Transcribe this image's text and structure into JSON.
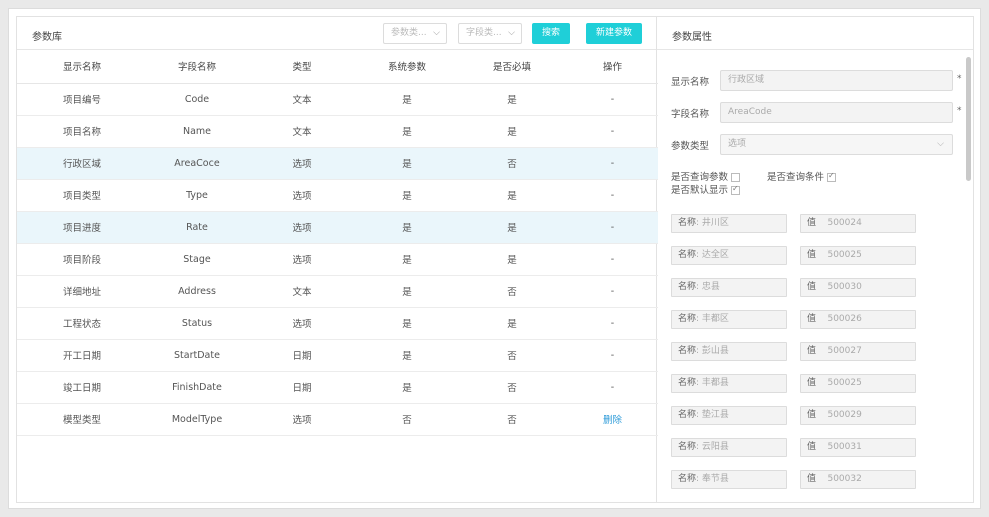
{
  "library": {
    "title": "参数库",
    "filter_type": "参数类...",
    "filter_field": "字段类...",
    "search_btn": "搜索",
    "add_btn": "新建参数",
    "columns": [
      "显示名称",
      "字段名称",
      "类型",
      "系统参数",
      "是否必填",
      "操作"
    ],
    "rows": [
      {
        "name": "项目编号",
        "field": "Code",
        "type": "文本",
        "system": "是",
        "required": "是",
        "op": "-"
      },
      {
        "name": "项目名称",
        "field": "Name",
        "type": "文本",
        "system": "是",
        "required": "是",
        "op": "-"
      },
      {
        "name": "行政区域",
        "field": "AreaCoce",
        "type": "选项",
        "system": "是",
        "required": "否",
        "op": "-"
      },
      {
        "name": "项目类型",
        "field": "Type",
        "type": "选项",
        "system": "是",
        "required": "是",
        "op": "-"
      },
      {
        "name": "项目进度",
        "field": "Rate",
        "type": "选项",
        "system": "是",
        "required": "是",
        "op": "-"
      },
      {
        "name": "项目阶段",
        "field": "Stage",
        "type": "选项",
        "system": "是",
        "required": "是",
        "op": "-"
      },
      {
        "name": "详细地址",
        "field": "Address",
        "type": "文本",
        "system": "是",
        "required": "否",
        "op": "-"
      },
      {
        "name": "工程状态",
        "field": "Status",
        "type": "选项",
        "system": "是",
        "required": "是",
        "op": "-"
      },
      {
        "name": "开工日期",
        "field": "StartDate",
        "type": "日期",
        "system": "是",
        "required": "否",
        "op": "-"
      },
      {
        "name": "竣工日期",
        "field": "FinishDate",
        "type": "日期",
        "system": "是",
        "required": "否",
        "op": "-"
      },
      {
        "name": "模型类型",
        "field": "ModelType",
        "type": "选项",
        "system": "否",
        "required": "否",
        "op": "删除"
      }
    ]
  },
  "props": {
    "title": "参数属性",
    "display_label": "显示名称",
    "display_value": "行政区域",
    "field_label": "字段名称",
    "field_value": "AreaCode",
    "type_label": "参数类型",
    "type_value": "选项",
    "required_mark": "*",
    "cb_query": "是否查询参数",
    "cb_filter": "是否查询条件",
    "cb_default": "是否默认显示",
    "options": [
      {
        "name": "井川区",
        "value": "500024"
      },
      {
        "name": "达全区",
        "value": "500025"
      },
      {
        "name": "忠县",
        "value": "500030"
      },
      {
        "name": "丰都区",
        "value": "500026"
      },
      {
        "name": "彭山县",
        "value": "500027"
      },
      {
        "name": "丰都县",
        "value": "500025"
      },
      {
        "name": "垫江县",
        "value": "500029"
      },
      {
        "name": "云阳县",
        "value": "500031"
      },
      {
        "name": "奉节县",
        "value": "500032"
      }
    ],
    "name_prefix": "名称",
    "value_prefix": "值"
  }
}
